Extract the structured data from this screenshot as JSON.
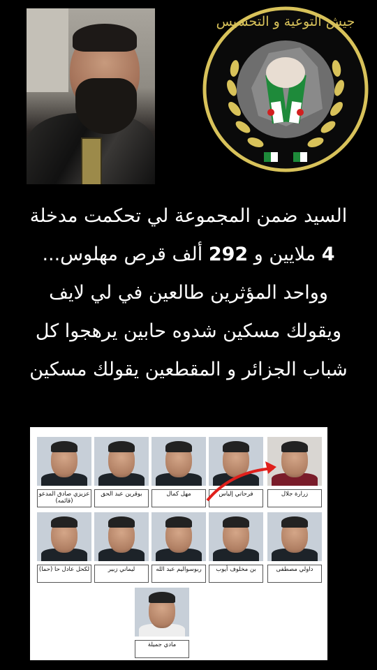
{
  "emblem": {
    "title": "جيش التوعية و التحسيس"
  },
  "headline": {
    "line1": "السيد ضمن المجموعة لي تحكمت مدخلة",
    "line2_prefix": "4",
    "line2_mid": " ملايين و ",
    "line2_num": "292",
    "line2_suffix": " ألف قرص مهلوس...",
    "line3": "وواحد المؤثرين طالعين في لي لايف",
    "line4": "ويقولك مسكين شدوه حابين يرهجوا كل",
    "line5": "شباب الجزائر و المقطعين يقولك مسكين"
  },
  "lineup": {
    "row1": [
      "عزيزي صادق المدعو (قائمه)",
      "بوقرين عبد الحق",
      "مهل كمال",
      "فرحاتي إلياس",
      "زرارة جلال"
    ],
    "row2": [
      "لكحل عادل حا (حما)",
      "ليماني زبير",
      "ربوسواليم عبد الله",
      "بن مخلوف أيوب",
      "داولي مصطفى"
    ],
    "row3": [
      "مادي جميلة"
    ]
  },
  "colors": {
    "emblem_gold": "#d8c25a",
    "arrow_red": "#e0201c",
    "emblem_dark": "#1e1e1e"
  }
}
